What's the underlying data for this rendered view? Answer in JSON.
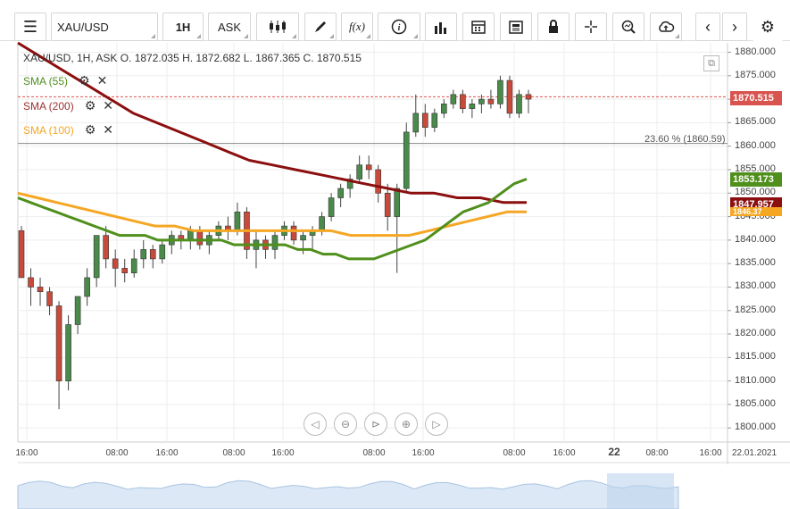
{
  "toolbar": {
    "symbol": "XAU/USD",
    "timeframe": "1H",
    "price_type": "ASK",
    "fx_label": "f(x)"
  },
  "legend": {
    "ohlc": "XAU/USD, 1H, ASK    O. 1872.035 H. 1872.682 L. 1867.365 C. 1870.515",
    "sma55": "SMA (55)",
    "sma200": "SMA (200)",
    "sma100": "SMA (100)"
  },
  "colors": {
    "sma55": "#4f8f1b",
    "sma200": "#8b0f0f",
    "sma100": "#f5a623",
    "up": "#4a8a4a",
    "down": "#c84a3a",
    "last_price": "#d9534f"
  },
  "fib_label": "23.60 % (1860.59)",
  "price_tags": {
    "last": "1870.515",
    "sma55": "1853.173",
    "sma200": "1847.957",
    "sma100": "1846.37"
  },
  "y_axis": [
    "1880.000",
    "1875.000",
    "1870.000",
    "1865.000",
    "1860.000",
    "1855.000",
    "1850.000",
    "1845.000",
    "1840.000",
    "1835.000",
    "1830.000",
    "1825.000",
    "1820.000",
    "1815.000",
    "1810.000",
    "1805.000",
    "1800.000"
  ],
  "x_axis": [
    "16:00",
    "08:00",
    "16:00",
    "08:00",
    "16:00",
    "08:00",
    "16:00",
    "08:00",
    "16:00",
    "22",
    "08:00",
    "16:00",
    "22.01.2021"
  ],
  "chart_data": {
    "type": "candlestick",
    "symbol": "XAU/USD",
    "interval": "1H",
    "ylim": [
      1797,
      1882
    ],
    "fib_level": 1860.59,
    "candles": [
      [
        1842,
        1843,
        1832,
        1832
      ],
      [
        1832,
        1834,
        1826,
        1830
      ],
      [
        1830,
        1832,
        1826,
        1829
      ],
      [
        1829,
        1830,
        1824,
        1826
      ],
      [
        1826,
        1827,
        1804,
        1810
      ],
      [
        1810,
        1824,
        1808,
        1822
      ],
      [
        1822,
        1828,
        1820,
        1828
      ],
      [
        1828,
        1834,
        1826,
        1832
      ],
      [
        1832,
        1840,
        1830,
        1841
      ],
      [
        1841,
        1843,
        1834,
        1836
      ],
      [
        1836,
        1838,
        1830,
        1834
      ],
      [
        1834,
        1836,
        1831,
        1833
      ],
      [
        1833,
        1838,
        1832,
        1836
      ],
      [
        1836,
        1840,
        1834,
        1838
      ],
      [
        1838,
        1839,
        1834,
        1836
      ],
      [
        1836,
        1840,
        1835,
        1839
      ],
      [
        1839,
        1842,
        1837,
        1841
      ],
      [
        1841,
        1842,
        1838,
        1840
      ],
      [
        1840,
        1843,
        1838,
        1842
      ],
      [
        1842,
        1843,
        1838,
        1839
      ],
      [
        1839,
        1842,
        1837,
        1841
      ],
      [
        1841,
        1844,
        1840,
        1843
      ],
      [
        1843,
        1845,
        1840,
        1842
      ],
      [
        1842,
        1848,
        1841,
        1846
      ],
      [
        1846,
        1847,
        1836,
        1838
      ],
      [
        1838,
        1842,
        1834,
        1840
      ],
      [
        1840,
        1841,
        1836,
        1838
      ],
      [
        1838,
        1842,
        1836,
        1841
      ],
      [
        1841,
        1844,
        1840,
        1843
      ],
      [
        1843,
        1844,
        1839,
        1840
      ],
      [
        1840,
        1842,
        1837,
        1841
      ],
      [
        1841,
        1843,
        1838,
        1842
      ],
      [
        1842,
        1846,
        1841,
        1845
      ],
      [
        1845,
        1850,
        1844,
        1849
      ],
      [
        1849,
        1852,
        1847,
        1851
      ],
      [
        1851,
        1854,
        1849,
        1853
      ],
      [
        1853,
        1858,
        1852,
        1856
      ],
      [
        1856,
        1858,
        1853,
        1855
      ],
      [
        1855,
        1856,
        1848,
        1850
      ],
      [
        1850,
        1852,
        1842,
        1845
      ],
      [
        1845,
        1852,
        1833,
        1851
      ],
      [
        1851,
        1865,
        1850,
        1863
      ],
      [
        1863,
        1871,
        1862,
        1867
      ],
      [
        1867,
        1869,
        1862,
        1864
      ],
      [
        1864,
        1868,
        1863,
        1867
      ],
      [
        1867,
        1870,
        1866,
        1869
      ],
      [
        1869,
        1872,
        1868,
        1871
      ],
      [
        1871,
        1872,
        1867,
        1868
      ],
      [
        1868,
        1870,
        1866,
        1869
      ],
      [
        1869,
        1871,
        1867,
        1870
      ],
      [
        1870,
        1872,
        1868,
        1869
      ],
      [
        1869,
        1875,
        1868,
        1874
      ],
      [
        1874,
        1875,
        1866,
        1867
      ],
      [
        1867,
        1872,
        1866,
        1871
      ],
      [
        1871,
        1872,
        1867,
        1870
      ]
    ],
    "sma55": [
      1849,
      1848,
      1847,
      1846,
      1845,
      1844,
      1843,
      1842,
      1841,
      1841,
      1841,
      1840,
      1840,
      1840,
      1840,
      1840,
      1840,
      1839,
      1839,
      1839,
      1839,
      1839,
      1838,
      1838,
      1837,
      1837,
      1836,
      1836,
      1836,
      1837,
      1838,
      1839,
      1840,
      1842,
      1844,
      1846,
      1847,
      1848,
      1850,
      1852,
      1853
    ],
    "sma200": [
      1882,
      1879,
      1876,
      1873,
      1870,
      1867,
      1865,
      1863,
      1861,
      1859,
      1857,
      1856,
      1855,
      1854,
      1853,
      1852,
      1851,
      1850,
      1850,
      1849,
      1849,
      1848,
      1848
    ],
    "sma100": [
      1850,
      1849,
      1848,
      1847,
      1846,
      1845,
      1844,
      1843,
      1843,
      1842,
      1842,
      1842,
      1842,
      1842,
      1842,
      1842,
      1842,
      1841,
      1841,
      1841,
      1841,
      1842,
      1843,
      1844,
      1845,
      1846,
      1846
    ],
    "volume_sketch": true
  }
}
